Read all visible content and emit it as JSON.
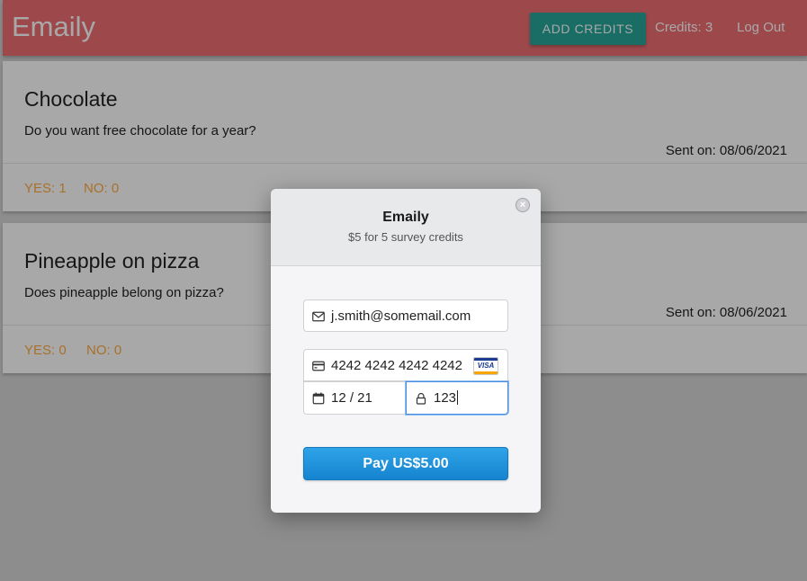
{
  "nav": {
    "brand": "Emaily",
    "add_credits_label": "ADD CREDITS",
    "credits_text": "Credits: 3",
    "logout_label": "Log Out"
  },
  "surveys": [
    {
      "title": "Chocolate",
      "body": "Do you want free chocolate for a year?",
      "sent": "Sent on: 08/06/2021",
      "yes": "YES: 1",
      "no": "NO: 0"
    },
    {
      "title": "Pineapple on pizza",
      "body": "Does pineapple belong on pizza?",
      "sent": "Sent on: 08/06/2021",
      "yes": "YES: 0",
      "no": "NO: 0"
    }
  ],
  "checkout": {
    "title": "Emaily",
    "subtitle": "$5 for 5 survey credits",
    "email_value": "j.smith@somemail.com",
    "card_number_value": "4242 4242 4242 4242",
    "card_brand": "VISA",
    "expiry_value": "12 / 21",
    "cvc_value": "123",
    "pay_label": "Pay US$5.00",
    "close_symbol": "×"
  },
  "icons": {
    "envelope": "envelope-icon",
    "card": "credit-card-icon",
    "calendar": "calendar-icon",
    "lock": "lock-icon",
    "close": "close-icon"
  },
  "colors": {
    "nav_bg": "#ee6e73",
    "add_credits_bg": "#26a69a",
    "vote_text": "#ffab40",
    "pay_button": "#1f94dc",
    "focus_border": "#4a90e2"
  }
}
